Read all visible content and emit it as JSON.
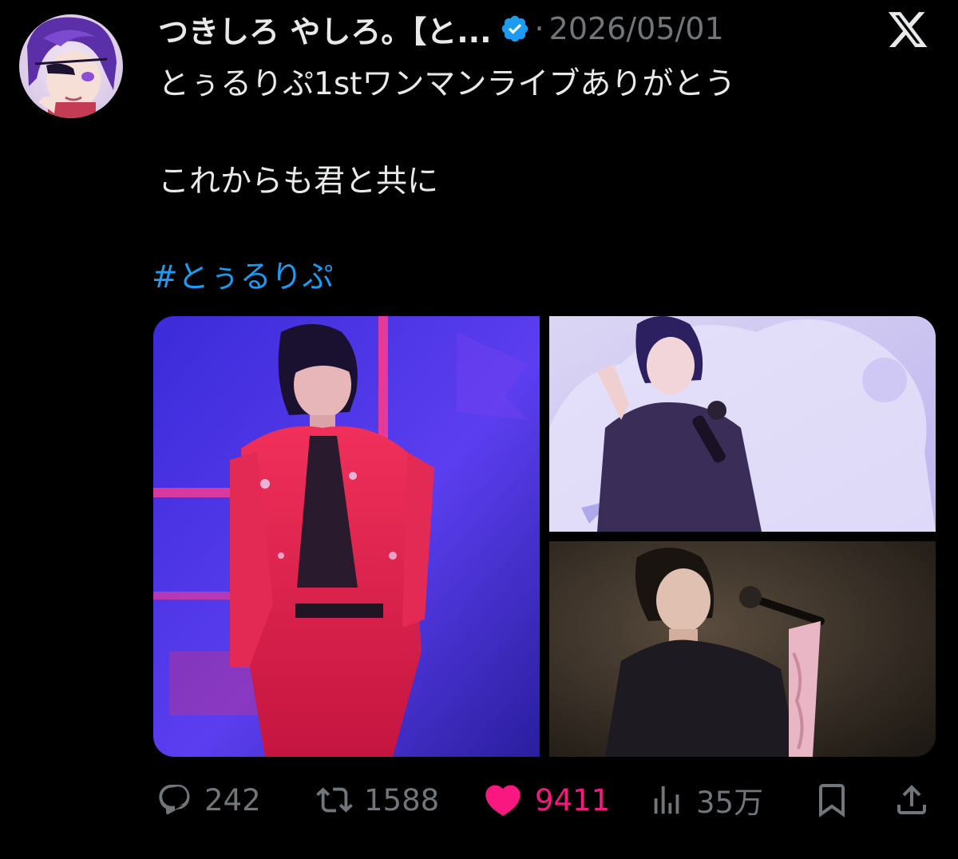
{
  "tweet": {
    "author_name": "つきしろ やしろ。【と...",
    "separator": "·",
    "date": "2026/05/01",
    "text_line1": "とぅるりぷ1stワンマンライブありがとう",
    "text_line2": "これからも君と共に",
    "hashtag": "#とぅるりぷ"
  },
  "icons": {
    "verified": "verified-badge-icon",
    "platform": "x-logo-icon",
    "reply": "reply-icon",
    "repost": "repost-icon",
    "like": "heart-icon",
    "views": "views-icon",
    "bookmark": "bookmark-icon",
    "share": "share-icon"
  },
  "actions": {
    "replies": "242",
    "reposts": "1588",
    "likes": "9411",
    "views": "35万"
  },
  "colors": {
    "background": "#000000",
    "text": "#e7e9ea",
    "muted": "#71767b",
    "link": "#1d9bf0",
    "like": "#f91880"
  }
}
